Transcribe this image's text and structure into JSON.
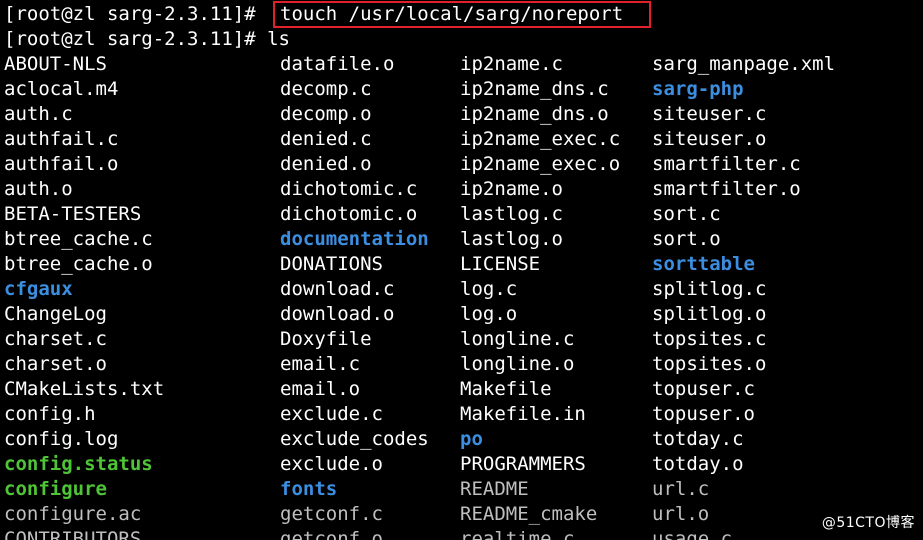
{
  "terminal": {
    "prompt1": "[root@zl sarg-2.3.11]# ",
    "command1": "touch /usr/local/sarg/noreport",
    "prompt2": "[root@zl sarg-2.3.11]# ",
    "command2": "ls",
    "colors": {
      "background": "#000000",
      "text": "#ffffff",
      "directory": "#3c8ee0",
      "executable": "#4fc437",
      "highlight_border": "#e0202a"
    }
  },
  "listing": {
    "rows": [
      [
        {
          "name": "ABOUT-NLS",
          "kind": "file"
        },
        {
          "name": "datafile.o",
          "kind": "file"
        },
        {
          "name": "ip2name.c",
          "kind": "file"
        },
        {
          "name": "sarg_manpage.xml",
          "kind": "file"
        }
      ],
      [
        {
          "name": "aclocal.m4",
          "kind": "file"
        },
        {
          "name": "decomp.c",
          "kind": "file"
        },
        {
          "name": "ip2name_dns.c",
          "kind": "file"
        },
        {
          "name": "sarg-php",
          "kind": "dir"
        }
      ],
      [
        {
          "name": "auth.c",
          "kind": "file"
        },
        {
          "name": "decomp.o",
          "kind": "file"
        },
        {
          "name": "ip2name_dns.o",
          "kind": "file"
        },
        {
          "name": "siteuser.c",
          "kind": "file"
        }
      ],
      [
        {
          "name": "authfail.c",
          "kind": "file"
        },
        {
          "name": "denied.c",
          "kind": "file"
        },
        {
          "name": "ip2name_exec.c",
          "kind": "file"
        },
        {
          "name": "siteuser.o",
          "kind": "file"
        }
      ],
      [
        {
          "name": "authfail.o",
          "kind": "file"
        },
        {
          "name": "denied.o",
          "kind": "file"
        },
        {
          "name": "ip2name_exec.o",
          "kind": "file"
        },
        {
          "name": "smartfilter.c",
          "kind": "file"
        }
      ],
      [
        {
          "name": "auth.o",
          "kind": "file"
        },
        {
          "name": "dichotomic.c",
          "kind": "file"
        },
        {
          "name": "ip2name.o",
          "kind": "file"
        },
        {
          "name": "smartfilter.o",
          "kind": "file"
        }
      ],
      [
        {
          "name": "BETA-TESTERS",
          "kind": "file"
        },
        {
          "name": "dichotomic.o",
          "kind": "file"
        },
        {
          "name": "lastlog.c",
          "kind": "file"
        },
        {
          "name": "sort.c",
          "kind": "file"
        }
      ],
      [
        {
          "name": "btree_cache.c",
          "kind": "file"
        },
        {
          "name": "documentation",
          "kind": "dir"
        },
        {
          "name": "lastlog.o",
          "kind": "file"
        },
        {
          "name": "sort.o",
          "kind": "file"
        }
      ],
      [
        {
          "name": "btree_cache.o",
          "kind": "file"
        },
        {
          "name": "DONATIONS",
          "kind": "file"
        },
        {
          "name": "LICENSE",
          "kind": "file"
        },
        {
          "name": "sorttable",
          "kind": "dir"
        }
      ],
      [
        {
          "name": "cfgaux",
          "kind": "dir"
        },
        {
          "name": "download.c",
          "kind": "file"
        },
        {
          "name": "log.c",
          "kind": "file"
        },
        {
          "name": "splitlog.c",
          "kind": "file"
        }
      ],
      [
        {
          "name": "ChangeLog",
          "kind": "file"
        },
        {
          "name": "download.o",
          "kind": "file"
        },
        {
          "name": "log.o",
          "kind": "file"
        },
        {
          "name": "splitlog.o",
          "kind": "file"
        }
      ],
      [
        {
          "name": "charset.c",
          "kind": "file"
        },
        {
          "name": "Doxyfile",
          "kind": "file"
        },
        {
          "name": "longline.c",
          "kind": "file"
        },
        {
          "name": "topsites.c",
          "kind": "file"
        }
      ],
      [
        {
          "name": "charset.o",
          "kind": "file"
        },
        {
          "name": "email.c",
          "kind": "file"
        },
        {
          "name": "longline.o",
          "kind": "file"
        },
        {
          "name": "topsites.o",
          "kind": "file"
        }
      ],
      [
        {
          "name": "CMakeLists.txt",
          "kind": "file"
        },
        {
          "name": "email.o",
          "kind": "file"
        },
        {
          "name": "Makefile",
          "kind": "file"
        },
        {
          "name": "topuser.c",
          "kind": "file"
        }
      ],
      [
        {
          "name": "config.h",
          "kind": "file"
        },
        {
          "name": "exclude.c",
          "kind": "file"
        },
        {
          "name": "Makefile.in",
          "kind": "file"
        },
        {
          "name": "topuser.o",
          "kind": "file"
        }
      ],
      [
        {
          "name": "config.log",
          "kind": "file"
        },
        {
          "name": "exclude_codes",
          "kind": "file"
        },
        {
          "name": "po",
          "kind": "dir"
        },
        {
          "name": "totday.c",
          "kind": "file"
        }
      ],
      [
        {
          "name": "config.status",
          "kind": "exec"
        },
        {
          "name": "exclude.o",
          "kind": "file"
        },
        {
          "name": "PROGRAMMERS",
          "kind": "file"
        },
        {
          "name": "totday.o",
          "kind": "file"
        }
      ],
      [
        {
          "name": "configure",
          "kind": "exec"
        },
        {
          "name": "fonts",
          "kind": "dir"
        },
        {
          "name": "README",
          "kind": "dim"
        },
        {
          "name": "url.c",
          "kind": "dim"
        }
      ],
      [
        {
          "name": "configure.ac",
          "kind": "dim"
        },
        {
          "name": "getconf.c",
          "kind": "dim"
        },
        {
          "name": "README_cmake",
          "kind": "dim"
        },
        {
          "name": "url.o",
          "kind": "dim"
        }
      ],
      [
        {
          "name": "CONTRIBUTORS",
          "kind": "dim"
        },
        {
          "name": "getconf.o",
          "kind": "dim"
        },
        {
          "name": "realtime.c",
          "kind": "dim"
        },
        {
          "name": "usage.c",
          "kind": "dim"
        }
      ]
    ]
  },
  "watermark": {
    "text": "@51CTO博客"
  }
}
